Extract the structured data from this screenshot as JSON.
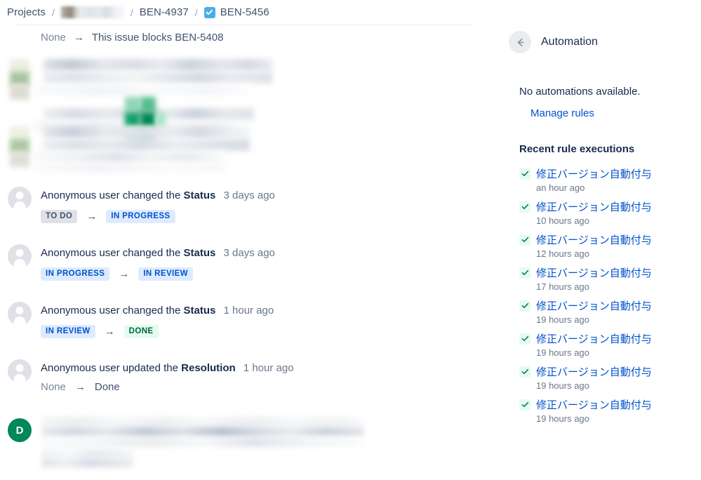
{
  "breadcrumb": {
    "root_label": "Projects",
    "separator": "/",
    "project_label": "",
    "parent_issue": "BEN-4937",
    "current_issue": "BEN-5456",
    "current_issue_icon": "task-checkbox-icon",
    "current_issue_icon_color": "#4BADE8"
  },
  "topbar_actions": {
    "feedback_label": "give-feedback-megaphone",
    "watch_label": "watch-issue-eye"
  },
  "activity": {
    "link_change": {
      "from": "None",
      "arrow": "→",
      "to": "This issue blocks BEN-5408"
    },
    "entries": [
      {
        "avatar": "anonymous",
        "avatar_letter": "",
        "actor": "Anonymous user",
        "verb": "changed the",
        "field": "Status",
        "time": "3 days ago",
        "from_label": "TO DO",
        "from_style": "lz-todo",
        "arrow": "→",
        "to_label": "IN PROGRESS",
        "to_style": "lz-prog"
      },
      {
        "avatar": "anonymous",
        "avatar_letter": "",
        "actor": "Anonymous user",
        "verb": "changed the",
        "field": "Status",
        "time": "3 days ago",
        "from_label": "IN PROGRESS",
        "from_style": "lz-prog",
        "arrow": "→",
        "to_label": "IN REVIEW",
        "to_style": "lz-rev"
      },
      {
        "avatar": "anonymous",
        "avatar_letter": "",
        "actor": "Anonymous user",
        "verb": "changed the",
        "field": "Status",
        "time": "1 hour ago",
        "from_label": "IN REVIEW",
        "from_style": "lz-rev",
        "arrow": "→",
        "to_label": "DONE",
        "to_style": "lz-done"
      },
      {
        "avatar": "anonymous",
        "avatar_letter": "",
        "actor": "Anonymous user",
        "verb": "updated the",
        "field": "Resolution",
        "time": "1 hour ago",
        "from_label": "None",
        "from_style": "plain",
        "arrow": "→",
        "to_label": "Done",
        "to_style": "plain"
      }
    ],
    "comment_entry": {
      "avatar": "initial",
      "avatar_letter": "D",
      "avatar_color": "#00875A"
    }
  },
  "automation_panel": {
    "back_icon": "back-arrow-icon",
    "title": "Automation",
    "empty_message": "No automations available.",
    "manage_rules_label": "Manage rules",
    "manage_rules_color": "#0052CC",
    "recent_heading": "Recent rule executions",
    "rules": [
      {
        "status_icon": "check-icon",
        "name": "修正バージョン自動付与",
        "time": "an hour ago"
      },
      {
        "status_icon": "check-icon",
        "name": "修正バージョン自動付与",
        "time": "10 hours ago"
      },
      {
        "status_icon": "check-icon",
        "name": "修正バージョン自動付与",
        "time": "12 hours ago"
      },
      {
        "status_icon": "check-icon",
        "name": "修正バージョン自動付与",
        "time": "17 hours ago"
      },
      {
        "status_icon": "check-icon",
        "name": "修正バージョン自動付与",
        "time": "19 hours ago"
      },
      {
        "status_icon": "check-icon",
        "name": "修正バージョン自動付与",
        "time": "19 hours ago"
      },
      {
        "status_icon": "check-icon",
        "name": "修正バージョン自動付与",
        "time": "19 hours ago"
      },
      {
        "status_icon": "check-icon",
        "name": "修正バージョン自動付与",
        "time": "19 hours ago"
      }
    ]
  },
  "colors": {
    "text_primary": "#172B4D",
    "text_subtle": "#6B778C",
    "link": "#0052CC",
    "done_green": "#006644",
    "avatar_green": "#00875A",
    "divider": "#EBECF0"
  }
}
